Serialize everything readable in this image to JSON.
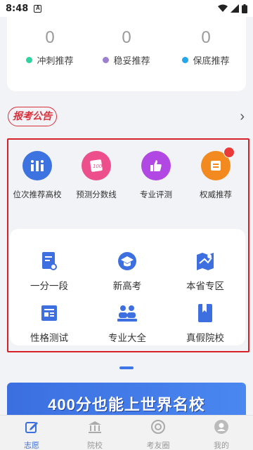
{
  "status_bar": {
    "time": "8:48",
    "notification_icon": "A"
  },
  "counts": [
    {
      "value": "0",
      "label": "冲刺推荐",
      "dot_color": "#2ed3a0"
    },
    {
      "value": "0",
      "label": "稳妥推荐",
      "dot_color": "#9b7fd0"
    },
    {
      "value": "0",
      "label": "保底推荐",
      "dot_color": "#23a7ea"
    }
  ],
  "notice": {
    "label": "报考公告",
    "chevron": "›"
  },
  "quick_tools": [
    {
      "label": "位次推荐高校",
      "icon": "bar-chart-icon",
      "color": "#3d73e0"
    },
    {
      "label": "预测分数线",
      "icon": "score-card-icon",
      "color": "#ec4f8c"
    },
    {
      "label": "专业评测",
      "icon": "thumbs-up-icon",
      "color": "#b148e3"
    },
    {
      "label": "权威推荐",
      "icon": "recommend-card-icon",
      "color": "#f28a1f"
    }
  ],
  "grid_tools": [
    {
      "label": "一分一段",
      "icon": "document-search-icon"
    },
    {
      "label": "新高考",
      "icon": "graduation-cap-icon"
    },
    {
      "label": "本省专区",
      "icon": "map-pin-icon"
    },
    {
      "label": "性格测试",
      "icon": "list-doc-icon"
    },
    {
      "label": "专业大全",
      "icon": "people-group-icon"
    },
    {
      "label": "真假院校",
      "icon": "bookmark-book-icon"
    }
  ],
  "banner": {
    "text": "400分也能上世界名校"
  },
  "tabs": [
    {
      "label": "志愿",
      "icon": "edit-icon",
      "active": true
    },
    {
      "label": "院校",
      "icon": "school-icon",
      "active": false
    },
    {
      "label": "考友圈",
      "icon": "target-icon",
      "active": false
    },
    {
      "label": "我的",
      "icon": "user-icon",
      "active": false
    }
  ],
  "colors": {
    "accent": "#3c6fe0",
    "highlight_frame": "#d82028",
    "notice_red": "#d9313a"
  }
}
